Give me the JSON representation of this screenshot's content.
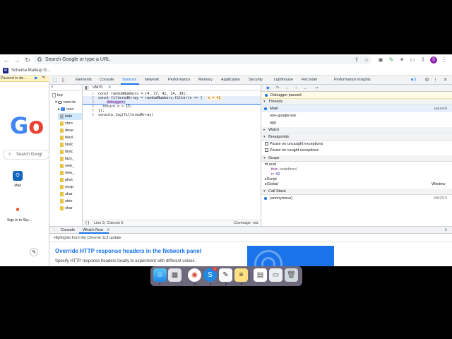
{
  "browser": {
    "address_placeholder": "Search Google or type a URL",
    "profile_initial": "S"
  },
  "bookmarks": {
    "item": "Schema Markup G..."
  },
  "page": {
    "paused_label": "Paused in de...",
    "google_letters": "Go",
    "search_placeholder": "Search Googl",
    "shortcuts": [
      {
        "label": "Mail"
      },
      {
        "label": "Sign in to Sky..."
      }
    ]
  },
  "devtools": {
    "tabs": [
      "Elements",
      "Console",
      "Sources",
      "Network",
      "Performance",
      "Memory",
      "Application",
      "Security",
      "Lighthouse",
      "Recorder",
      "Performance insights"
    ],
    "issues_count": "3",
    "tree": {
      "top": "top",
      "new_tab": "new-ta",
      "items": [
        "icon",
        "inde",
        "chro",
        "drive",
        "feed",
        "histc",
        "histc",
        "lazy_",
        "new_",
        "new_",
        "phot",
        "recip",
        "shar",
        "strin",
        "shar"
      ]
    },
    "editor": {
      "tab": "VM70",
      "lines": [
        {
          "num": "1",
          "code": "const randomNumbers = [4, 17, 42, 14, 39];"
        },
        {
          "num": "2",
          "code": "const filteredArray = randomNumbers.filter(n => {",
          "inline": "n = 42"
        },
        {
          "num": "3",
          "code": "debugger;"
        },
        {
          "num": "4",
          "code": "  return n > 15;"
        },
        {
          "num": "5",
          "code": "});"
        },
        {
          "num": "6",
          "code": "console.log(filteredArray)"
        }
      ],
      "status_braces": "{ }",
      "status_pos": "Line 3, Column 5",
      "coverage": "Coverage: n/a"
    },
    "debugger": {
      "paused_msg": "Debugger paused",
      "threads_label": "Threads",
      "threads": [
        {
          "name": "Main",
          "state": "paused"
        },
        {
          "name": "one-google-bar",
          "state": ""
        },
        {
          "name": "app",
          "state": ""
        }
      ],
      "watch_label": "Watch",
      "breakpoints_label": "Breakpoints",
      "bp_options": [
        "Pause on uncaught exceptions",
        "Pause on caught exceptions"
      ],
      "scope_label": "Scope",
      "scope": {
        "local": "Local",
        "this_key": "this:",
        "this_val": "undefined",
        "n_key": "n:",
        "n_val": "42",
        "script": "Script",
        "global": "Global",
        "global_val": "Window"
      },
      "callstack_label": "Call Stack",
      "callstack": [
        {
          "name": "(anonymous)",
          "loc": "VM70:3"
        }
      ]
    },
    "drawer": {
      "tabs": [
        "Console",
        "What's New"
      ],
      "heading": "Highlights from the Chrome 113 update",
      "title": "Override HTTP response headers in the Network panel",
      "desc": "Specify HTTP response headers locally to experiment with different values."
    }
  },
  "dock": {
    "chrome_badge": "3"
  }
}
